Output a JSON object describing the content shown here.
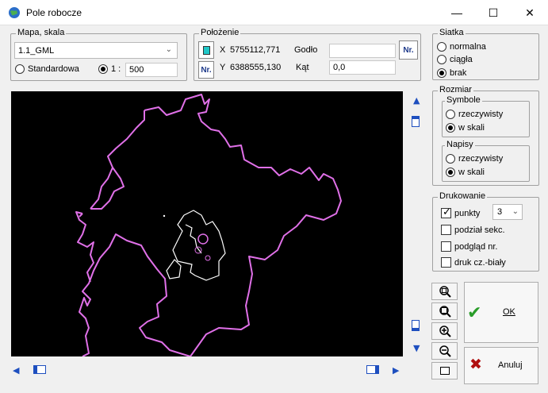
{
  "window": {
    "title": "Pole robocze"
  },
  "mapa": {
    "group_label": "Mapa, skala",
    "dataset": "1.1_GML",
    "standard_label": "Standardowa",
    "scale_prefix": "1 :",
    "scale_value": "500",
    "selected_mode": "scale"
  },
  "polozenie": {
    "group_label": "Położenie",
    "x_label": "X",
    "x_value": "5755112,771",
    "y_label": "Y",
    "y_value": "6388555,130",
    "godlo_label": "Godło",
    "godlo_value": "",
    "kat_label": "Kąt",
    "kat_value": "0,0",
    "nr_label": "Nr."
  },
  "siatka": {
    "group_label": "Siatka",
    "options": [
      "normalna",
      "ciągła",
      "brak"
    ],
    "selected": "brak"
  },
  "rozmiar": {
    "group_label": "Rozmiar",
    "symbole_label": "Symbole",
    "napisy_label": "Napisy",
    "opt_rzeczywisty": "rzeczywisty",
    "opt_wskali": "w skali",
    "symbole_selected": "w skali",
    "napisy_selected": "w skali"
  },
  "drukowanie": {
    "group_label": "Drukowanie",
    "punkty_label": "punkty",
    "punkty_checked": true,
    "punkty_value": "3",
    "podzial_label": "podział sekc.",
    "podzial_checked": false,
    "podglad_label": "podgląd nr.",
    "podglad_checked": false,
    "druk_label": "druk cz.-biały",
    "druk_checked": false
  },
  "buttons": {
    "ok_label": "OK",
    "cancel_label": "Anuluj"
  },
  "colors": {
    "map_bg": "#000000",
    "boundary": "#e070e8",
    "ok_check": "#2a9d2a",
    "cancel_x": "#b01010",
    "arrow": "#1e4fbf"
  }
}
